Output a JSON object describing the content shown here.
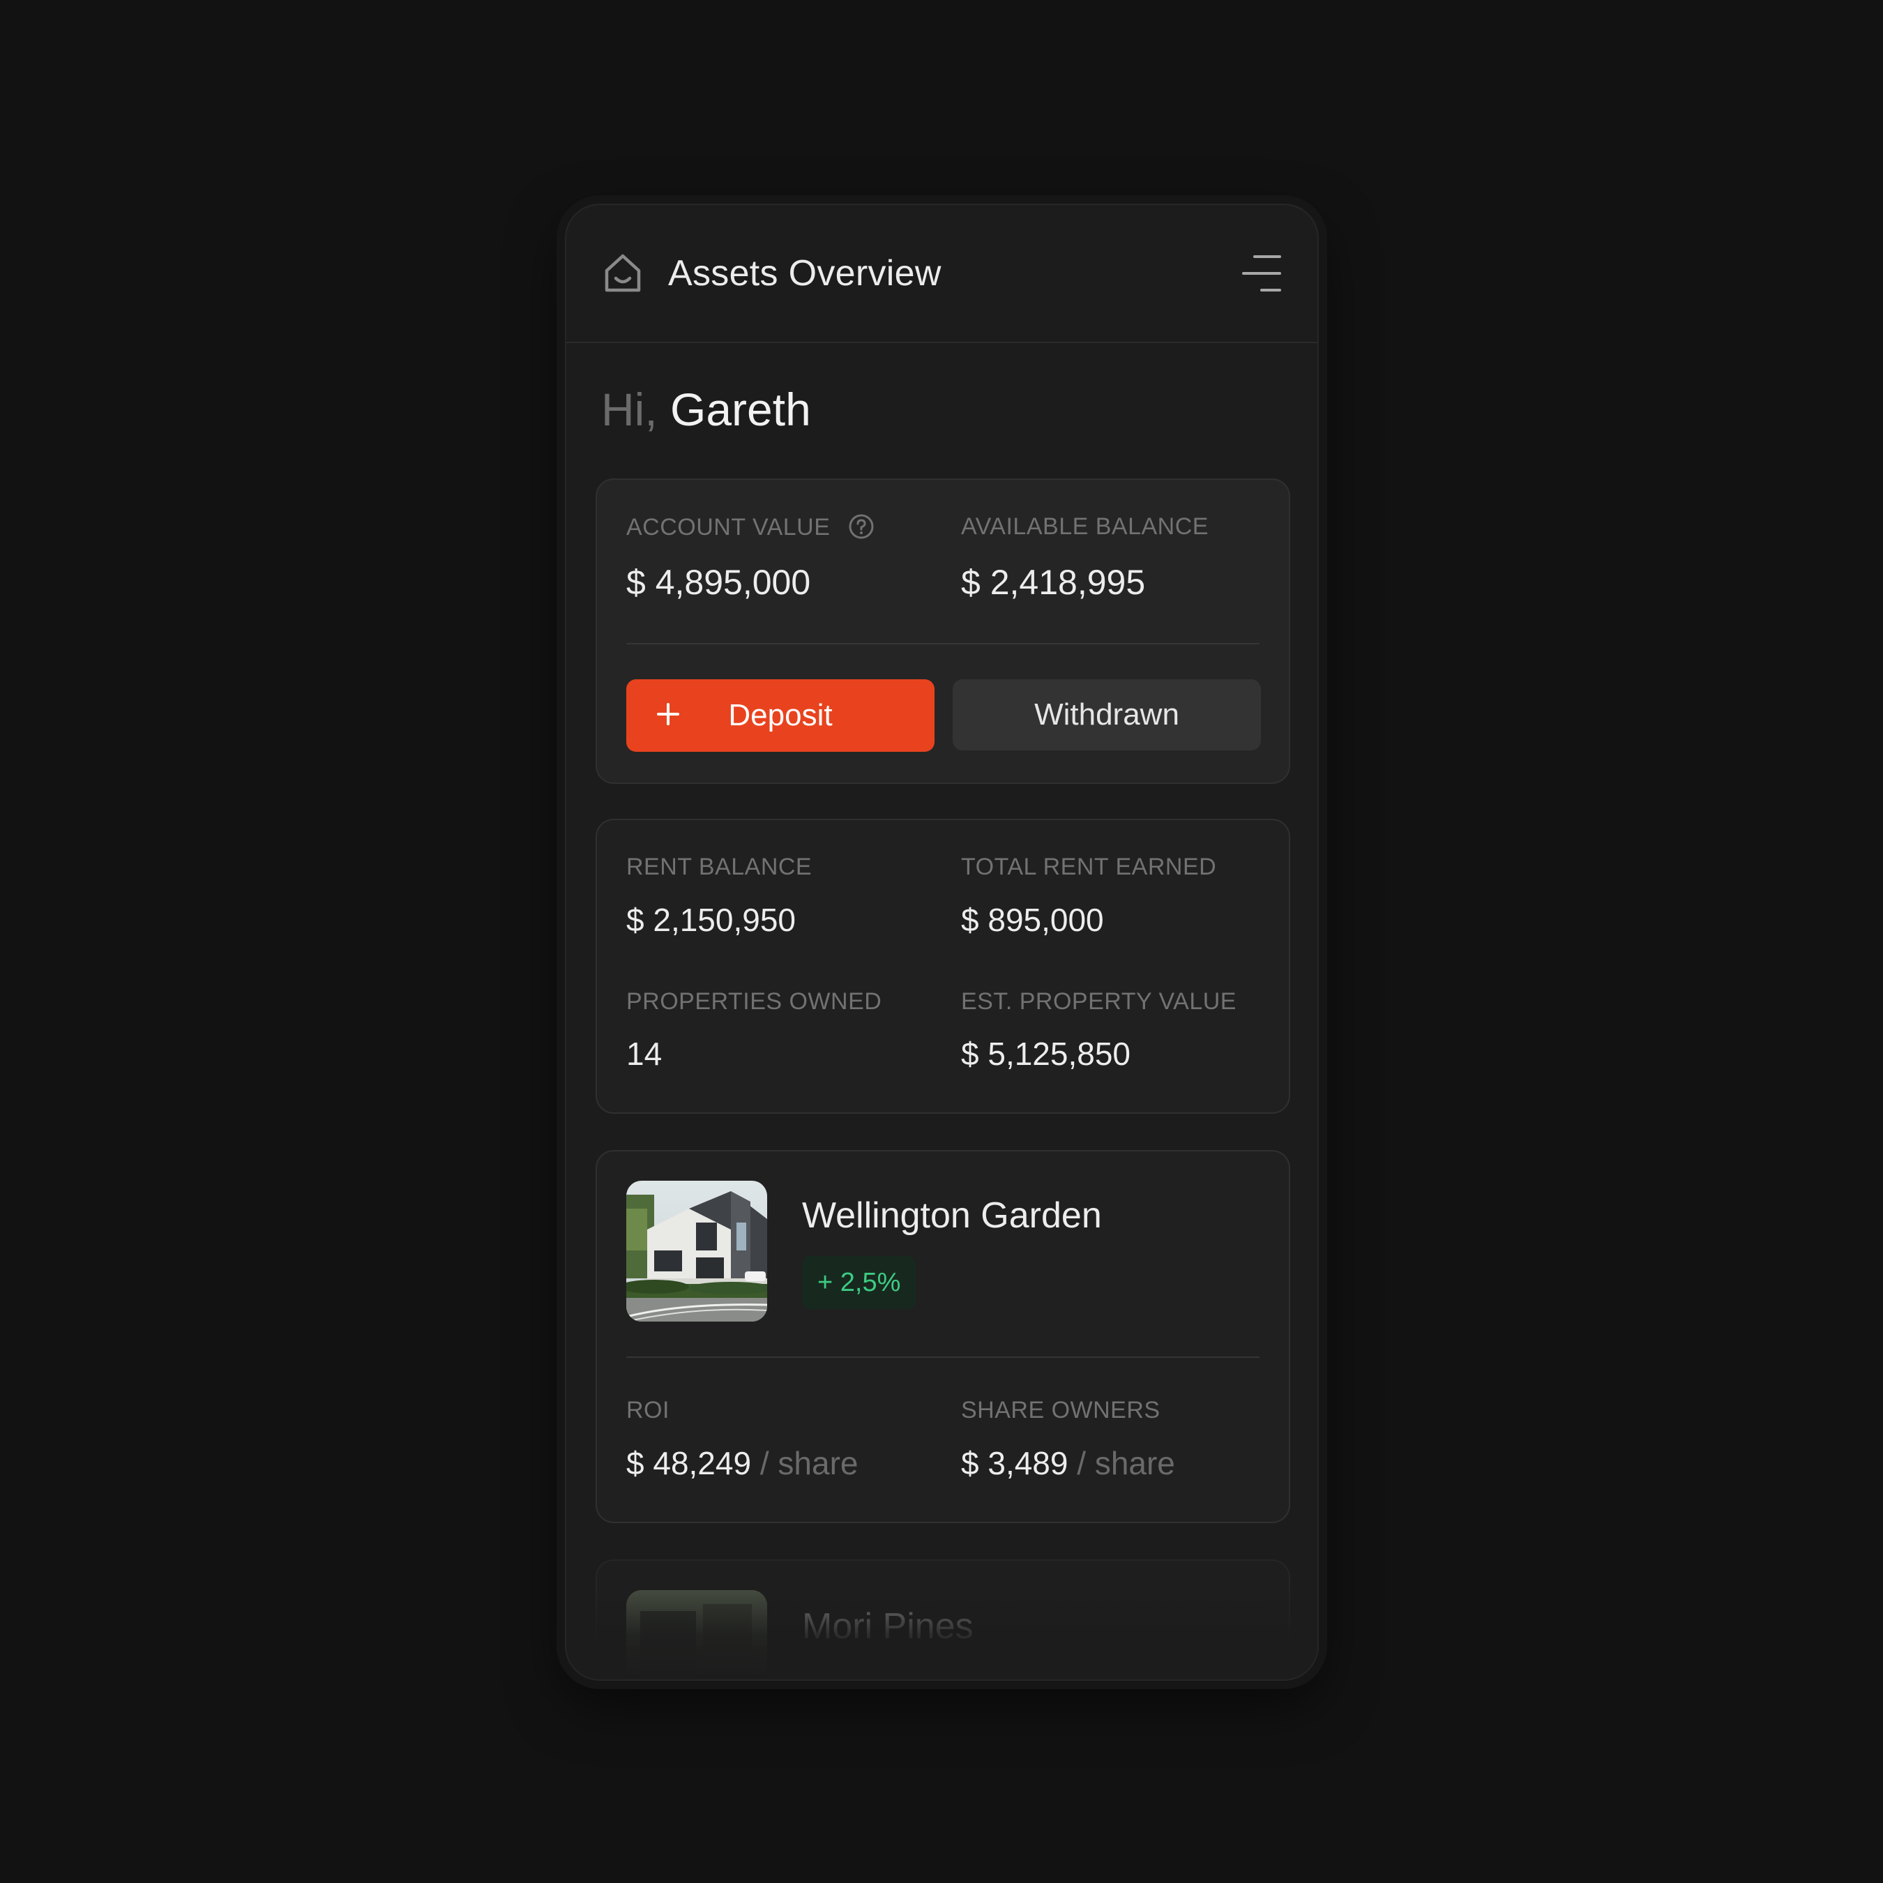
{
  "header": {
    "title": "Assets Overview",
    "home_icon": "home-icon",
    "menu_icon": "menu-icon"
  },
  "greeting": {
    "prefix": "Hi,",
    "name": "Gareth"
  },
  "account": {
    "account_value_label": "ACCOUNT VALUE",
    "account_value": "$ 4,895,000",
    "available_balance_label": "AVAILABLE BALANCE",
    "available_balance": "$ 2,418,995",
    "deposit_label": "Deposit",
    "withdraw_label": "Withdrawn"
  },
  "stats": {
    "rent_balance_label": "RENT BALANCE",
    "rent_balance": "$ 2,150,950",
    "total_rent_label": "TOTAL RENT EARNED",
    "total_rent": "$ 895,000",
    "properties_owned_label": "PROPERTIES OWNED",
    "properties_owned": "14",
    "est_value_label": "EST. PROPERTY VALUE",
    "est_value": "$ 5,125,850"
  },
  "properties": [
    {
      "name": "Wellington Garden",
      "change": "+ 2,5%",
      "roi_label": "ROI",
      "roi_value": "$ 48,249",
      "roi_unit": "/ share",
      "share_owners_label": "SHARE OWNERS",
      "share_owners_value": "$ 3,489",
      "share_owners_unit": "/ share"
    },
    {
      "name": "Mori Pines"
    }
  ],
  "colors": {
    "accent": "#e8431e",
    "positive": "#3ecb83",
    "background": "#121212",
    "card": "#242424"
  }
}
